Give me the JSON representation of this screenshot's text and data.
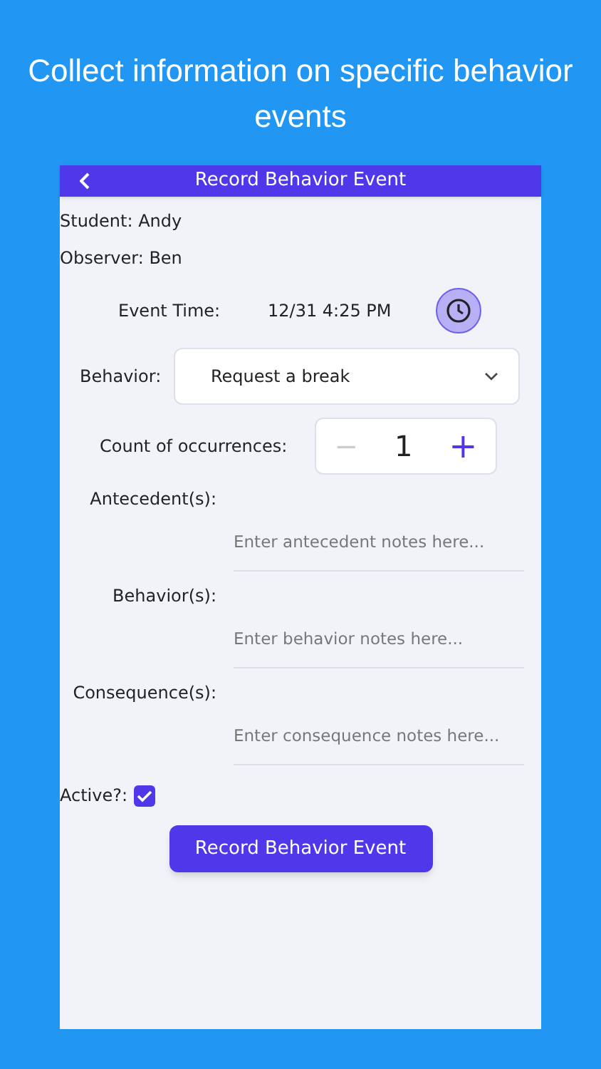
{
  "headline": "Collect information on specific behavior events",
  "header": {
    "title": "Record Behavior Event"
  },
  "student": "Student: Andy",
  "observer": "Observer: Ben",
  "event_time": {
    "label": "Event Time:",
    "value": "12/31 4:25 PM"
  },
  "behavior": {
    "label": "Behavior:",
    "value": "Request a break"
  },
  "count": {
    "label": "Count of occurrences:",
    "value": "1",
    "minus": "−",
    "plus": "+"
  },
  "notes": [
    {
      "label": "Antecedent(s):",
      "placeholder": "Enter antecedent notes here..."
    },
    {
      "label": "Behavior(s):",
      "placeholder": "Enter behavior notes here..."
    },
    {
      "label": "Consequence(s):",
      "placeholder": "Enter consequence notes here..."
    }
  ],
  "active": {
    "label": "Active?:",
    "checked": true
  },
  "submit": "Record Behavior Event"
}
